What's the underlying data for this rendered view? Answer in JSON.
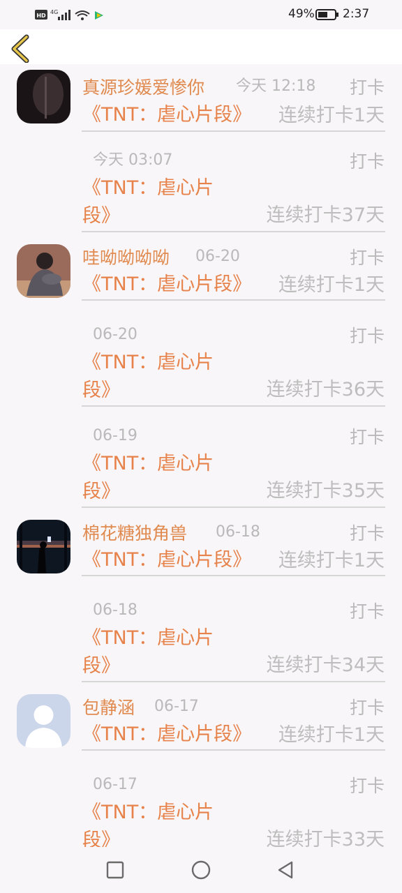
{
  "status_bar": {
    "left": "HD 4G",
    "battery": "49%",
    "time": "2:37"
  },
  "entries": [
    {
      "avatar": "dark",
      "name": "真源珍媛爱惨你",
      "time": "今天 12:18",
      "checkin": "打卡",
      "book": "《TNT：虐心片段》",
      "streak": "连续打卡1天"
    },
    {
      "avatar": "",
      "name": "",
      "time": "今天 03:07",
      "checkin": "打卡",
      "book": "《TNT：虐心片段》",
      "streak": "连续打卡37天"
    },
    {
      "avatar": "person",
      "name": "哇呦呦呦呦",
      "time": "06-20",
      "checkin": "打卡",
      "book": "《TNT：虐心片段》",
      "streak": "连续打卡1天"
    },
    {
      "avatar": "",
      "name": "",
      "time": "06-20",
      "checkin": "打卡",
      "book": "《TNT：虐心片段》",
      "streak": "连续打卡36天"
    },
    {
      "avatar": "",
      "name": "",
      "time": "06-19",
      "checkin": "打卡",
      "book": "《TNT：虐心片段》",
      "streak": "连续打卡35天"
    },
    {
      "avatar": "night",
      "name": "棉花糖独角兽",
      "time": "06-18",
      "checkin": "打卡",
      "book": "《TNT：虐心片段》",
      "streak": "连续打卡1天"
    },
    {
      "avatar": "",
      "name": "",
      "time": "06-18",
      "checkin": "打卡",
      "book": "《TNT：虐心片段》",
      "streak": "连续打卡34天"
    },
    {
      "avatar": "default",
      "name": "包静涵",
      "time": "06-17",
      "checkin": "打卡",
      "book": "《TNT：虐心片段》",
      "streak": "连续打卡1天"
    },
    {
      "avatar": "",
      "name": "",
      "time": "06-17",
      "checkin": "打卡",
      "book": "《TNT：虐心片段》",
      "streak": "连续打卡33天"
    }
  ],
  "icons": {
    "back": "chevron-left-icon",
    "nav": [
      "square-icon",
      "circle-icon",
      "triangle-back-icon"
    ]
  },
  "colors": {
    "accent": "#e6824a",
    "name": "#e08a50",
    "muted": "#bdbdbd",
    "back": "#e6c64a"
  }
}
